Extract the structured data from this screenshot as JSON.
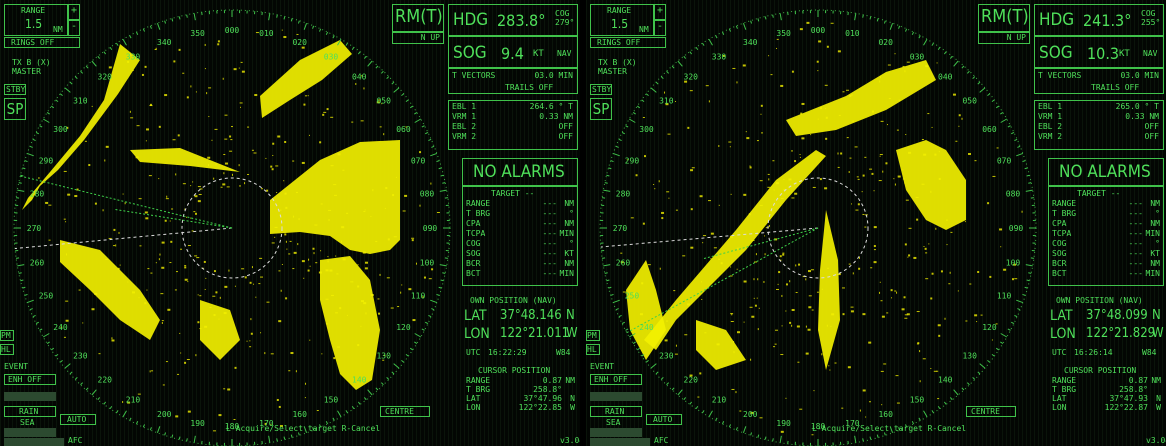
{
  "screens": [
    {
      "range_label": "RANGE",
      "range_value": "1.5",
      "range_unit": "NM",
      "plus": "+",
      "minus": "-",
      "rings": "RINGS OFF",
      "tx_line1": "TX B (X)",
      "tx_line2": "MASTER",
      "stby": "STBY",
      "sp": "SP",
      "pm": "PM",
      "hl": "HL",
      "event": "EVENT",
      "enh": "ENH OFF",
      "rain": "RAIN",
      "sea": "SEA",
      "auto": "AUTO",
      "afc": "AFC",
      "mode": "RM(T)",
      "north_up": "N UP",
      "hdg_label": "HDG",
      "hdg_value": "283.8°",
      "cog_label": "COG",
      "cog_value": "279°",
      "sog_label": "SOG",
      "sog_value": "9.4",
      "sog_unit": "KT",
      "nav": "NAV",
      "vectors": "T VECTORS",
      "vectors_value": "03.0 MIN",
      "trails": "TRAILS OFF",
      "ebl1_label": "EBL 1",
      "ebl1_value": "264.6 ° T",
      "vrm1_label": "VRM 1",
      "vrm1_value": "0.33 NM",
      "ebl2_label": "EBL 2",
      "ebl2_value": "OFF",
      "vrm2_label": "VRM 2",
      "vrm2_value": "OFF",
      "alarms": "NO ALARMS",
      "target_title": "TARGET --",
      "target_rows": [
        {
          "label": "RANGE",
          "value": "---",
          "unit": "NM"
        },
        {
          "label": "T BRG",
          "value": "---",
          "unit": "°"
        },
        {
          "label": "CPA",
          "value": "---",
          "unit": "NM"
        },
        {
          "label": "TCPA",
          "value": "---",
          "unit": "MIN"
        },
        {
          "label": "COG",
          "value": "---",
          "unit": "°"
        },
        {
          "label": "SOG",
          "value": "---",
          "unit": "KT"
        },
        {
          "label": "BCR",
          "value": "---",
          "unit": "NM"
        },
        {
          "label": "BCT",
          "value": "---",
          "unit": "MIN"
        }
      ],
      "own_pos_title": "OWN POSITION (NAV)",
      "lat_label": "LAT",
      "lat_value": "37°48.146",
      "lat_dir": "N",
      "lon_label": "LON",
      "lon_value": "122°21.011",
      "lon_dir": "W",
      "utc_label": "UTC",
      "utc_value": "16:22:29",
      "datum": "W84",
      "cursor_title": "CURSOR POSITION",
      "cursor_rows": [
        {
          "label": "RANGE",
          "value": "0.87",
          "unit": "NM"
        },
        {
          "label": "T BRG",
          "value": "258.8°",
          "unit": ""
        },
        {
          "label": "LAT",
          "value": "37°47.96",
          "unit": "N"
        },
        {
          "label": "LON",
          "value": "122°22.85",
          "unit": "W"
        }
      ],
      "centre": "CENTRE",
      "hint": "",
      "version": "v3.04",
      "bearings": [
        "350",
        "000",
        "010",
        "020",
        "030",
        "040",
        "050",
        "060",
        "070",
        "080",
        "090",
        "100",
        "110",
        "120",
        "130",
        "140",
        "150",
        "160",
        "170",
        "180",
        "190",
        "200",
        "210",
        "220",
        "230",
        "240",
        "250",
        "260",
        "270",
        "280",
        "290",
        "300",
        "310",
        "320",
        "330",
        "340"
      ],
      "visible_bearings": [
        "350",
        "000",
        "010",
        "020",
        "030",
        "040",
        "050",
        "060",
        "070",
        "080",
        "090",
        "100",
        "110",
        "120",
        "130",
        "140",
        "150",
        "160",
        "170",
        "180",
        "190",
        "200",
        "210",
        "220",
        "230",
        "240",
        "250",
        "260",
        "270",
        "280",
        "290",
        "300",
        "310",
        "320",
        "330",
        "340"
      ]
    },
    {
      "range_label": "RANGE",
      "range_value": "1.5",
      "range_unit": "NM",
      "plus": "+",
      "minus": "-",
      "rings": "RINGS OFF",
      "tx_line1": "TX B (X)",
      "tx_line2": "MASTER",
      "stby": "STBY",
      "sp": "SP",
      "pm": "PM",
      "hl": "HL",
      "event": "EVENT",
      "enh": "ENH OFF",
      "rain": "RAIN",
      "sea": "SEA",
      "auto": "AUTO",
      "afc": "AFC",
      "mode": "RM(T)",
      "north_up": "N UP",
      "hdg_label": "HDG",
      "hdg_value": "241.3°",
      "cog_label": "COG",
      "cog_value": "255°",
      "sog_label": "SOG",
      "sog_value": "10.3",
      "sog_unit": "KT",
      "nav": "NAV",
      "vectors": "T VECTORS",
      "vectors_value": "03.0 MIN",
      "trails": "TRAILS OFF",
      "ebl1_label": "EBL 1",
      "ebl1_value": "265.0 ° T",
      "vrm1_label": "VRM 1",
      "vrm1_value": "0.33 NM",
      "ebl2_label": "EBL 2",
      "ebl2_value": "OFF",
      "vrm2_label": "VRM 2",
      "vrm2_value": "OFF",
      "alarms": "NO ALARMS",
      "target_title": "TARGET --",
      "target_rows": [
        {
          "label": "RANGE",
          "value": "---",
          "unit": "NM"
        },
        {
          "label": "T BRG",
          "value": "---",
          "unit": "°"
        },
        {
          "label": "CPA",
          "value": "---",
          "unit": "NM"
        },
        {
          "label": "TCPA",
          "value": "---",
          "unit": "MIN"
        },
        {
          "label": "COG",
          "value": "---",
          "unit": "°"
        },
        {
          "label": "SOG",
          "value": "---",
          "unit": "KT"
        },
        {
          "label": "BCR",
          "value": "---",
          "unit": "NM"
        },
        {
          "label": "BCT",
          "value": "---",
          "unit": "MIN"
        }
      ],
      "own_pos_title": "OWN POSITION (NAV)",
      "lat_label": "LAT",
      "lat_value": "37°48.099",
      "lat_dir": "N",
      "lon_label": "LON",
      "lon_value": "122°21.829",
      "lon_dir": "W",
      "utc_label": "UTC",
      "utc_value": "16:26:14",
      "datum": "W84",
      "cursor_title": "CURSOR POSITION",
      "cursor_rows": [
        {
          "label": "RANGE",
          "value": "0.87",
          "unit": "NM"
        },
        {
          "label": "T BRG",
          "value": "258.8°",
          "unit": ""
        },
        {
          "label": "LAT",
          "value": "37°47.93",
          "unit": "N"
        },
        {
          "label": "LON",
          "value": "122°22.87",
          "unit": "W"
        }
      ],
      "centre": "CENTRE",
      "hint": "L-Acquire/Select target  R-Cancel",
      "version": "v3.04",
      "bearings": [
        "350",
        "000",
        "010",
        "020",
        "030",
        "040",
        "050",
        "060",
        "070",
        "080",
        "090",
        "100",
        "110",
        "120",
        "130",
        "140",
        "150",
        "160",
        "170",
        "180",
        "190",
        "200",
        "210",
        "220",
        "230",
        "240",
        "250",
        "260",
        "270",
        "280",
        "290",
        "300",
        "310",
        "320",
        "330",
        "340"
      ],
      "visible_bearings": [
        "350",
        "000",
        "010",
        "020",
        "030",
        "040",
        "050",
        "060",
        "070",
        "080",
        "090",
        "100",
        "110",
        "120",
        "130",
        "140",
        "150",
        "160",
        "170",
        "180",
        "190",
        "200",
        "210",
        "220",
        "230",
        "240",
        "250",
        "260",
        "270",
        "280",
        "290",
        "300",
        "310",
        "320",
        "330",
        "340"
      ]
    }
  ],
  "hint_left": "L-Acquire/Select target  R-Cancel",
  "colors": {
    "green": "#4fe05a",
    "echo": "#f2f000",
    "background": "#030603"
  }
}
